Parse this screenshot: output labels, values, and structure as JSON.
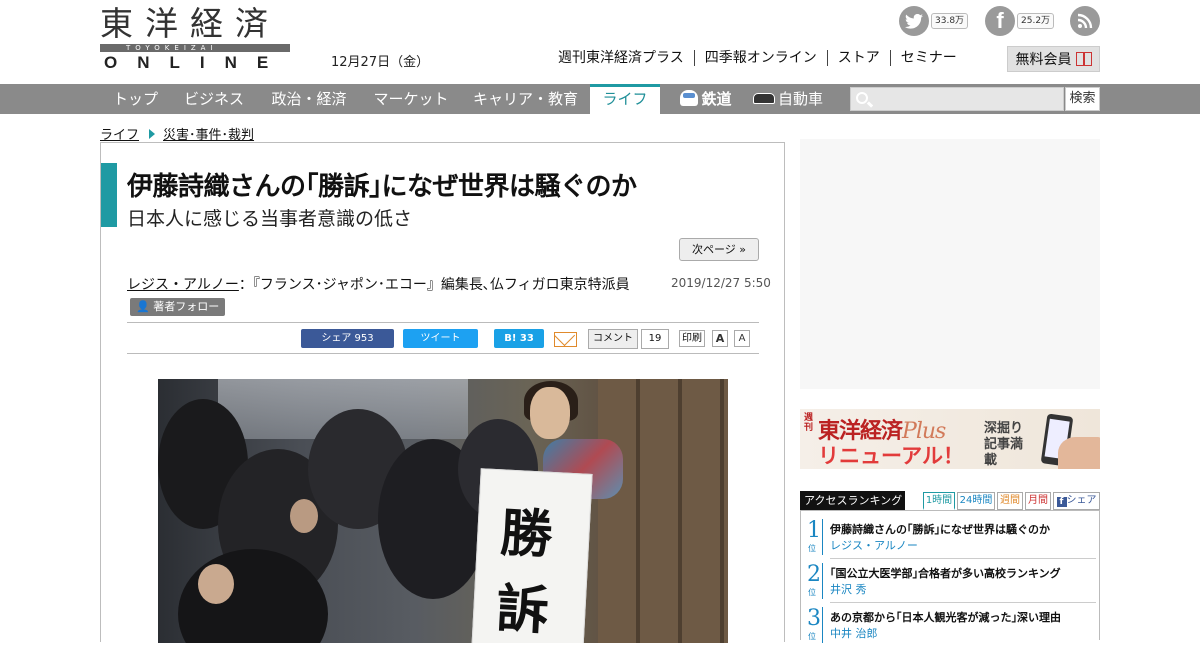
{
  "logo": {
    "jp": "東洋経済",
    "roman": "TOYOKEIZAI",
    "en": "ONLINE"
  },
  "date": "12月27日（金）",
  "social": {
    "twitter_count": "33.8万",
    "facebook_count": "25.2万"
  },
  "topnav": [
    "週刊東洋経済プラス",
    "四季報オンライン",
    "ストア",
    "セミナー"
  ],
  "free_member": "無料会員",
  "mainnav": [
    {
      "label": "トップ"
    },
    {
      "label": "ビジネス"
    },
    {
      "label": "政治・経済"
    },
    {
      "label": "マーケット"
    },
    {
      "label": "キャリア・教育"
    },
    {
      "label": "ライフ",
      "active": true
    },
    {
      "label": "鉄道"
    },
    {
      "label": "自動車"
    }
  ],
  "search": {
    "placeholder": "",
    "button": "検索"
  },
  "breadcrumb": [
    "ライフ",
    "災害･事件･裁判"
  ],
  "article": {
    "title": "伊藤詩織さんの｢勝訴｣になぜ世界は騒ぐのか",
    "subtitle": "日本人に感じる当事者意識の低さ",
    "next_page": "次ページ »",
    "author": "レジス・アルノー",
    "author_desc": "：『フランス･ジャポン･エコー』編集長､仏フィガロ東京特派員",
    "follow": "著者フォロー",
    "date": "2019/12/27 5:50",
    "share": {
      "facebook": "シェア 953",
      "twitter": "ツイート",
      "hatena": "B! 33",
      "comment": "コメント",
      "comment_count": "19",
      "print": "印刷",
      "font_large": "A",
      "font_small": "A"
    },
    "photo_sign": [
      "勝",
      "訴"
    ]
  },
  "banner": {
    "weekly": "週刊",
    "title": "東洋経済",
    "plus": "Plus",
    "renewal": "リニューアル！",
    "tagline": "深掘り記事満載"
  },
  "ranking": {
    "title": "アクセスランキング",
    "tabs": [
      "1時間",
      "24時間",
      "週間",
      "月間",
      "シェア"
    ],
    "rank_unit": "位",
    "items": [
      {
        "rank": "1",
        "title": "伊藤詩織さんの｢勝訴｣になぜ世界は騒ぐのか",
        "author": "レジス・アルノー"
      },
      {
        "rank": "2",
        "title": "｢国公立大医学部｣合格者が多い高校ランキング",
        "author": "井沢 秀"
      },
      {
        "rank": "3",
        "title": "あの京都から｢日本人観光客が減った｣深い理由",
        "author": "中井 治郎"
      }
    ]
  },
  "colors": {
    "accent": "#1f9aa3",
    "nav_bg": "#8a8a8a",
    "rank_blue": "#1a86c2"
  }
}
